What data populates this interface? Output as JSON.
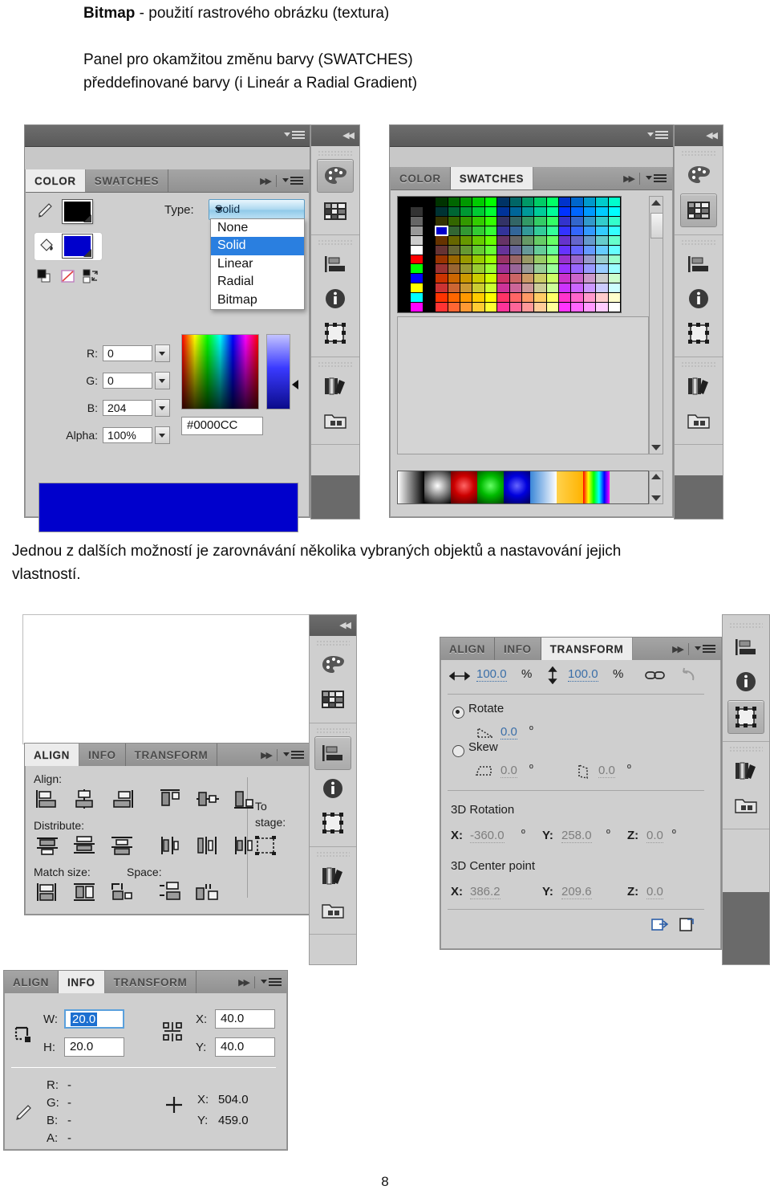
{
  "document": {
    "heading_bold": "Bitmap",
    "heading_rest": " - použití rastrového obrázku (textura)",
    "para1_line1": "Panel pro okamžitou změnu barvy (SWATCHES)",
    "para1_line2": "předdefinované barvy (i Lineár a Radial Gradient)",
    "para2": "Jednou z dalších možností je zarovnávání několika vybraných objektů a nastavování jejich",
    "para2_last": "vlastností.",
    "page_number": "8"
  },
  "color_panel": {
    "tabs": [
      {
        "label": "COLOR",
        "active": true
      },
      {
        "label": "SWATCHES",
        "active": false
      }
    ],
    "type_label": "Type:",
    "type_value": "Solid",
    "type_options": [
      "None",
      "Solid",
      "Linear",
      "Radial",
      "Bitmap"
    ],
    "type_selected_index": 1,
    "stroke_color": "#000000",
    "fill_color": "#0000CC",
    "fields": [
      {
        "label": "R:",
        "value": "0"
      },
      {
        "label": "G:",
        "value": "0"
      },
      {
        "label": "B:",
        "value": "204"
      },
      {
        "label": "Alpha:",
        "value": "100%"
      }
    ],
    "hex_value": "#0000CC",
    "preview_color": "#0000CC",
    "icons": {
      "eyedropper": "pencil-icon",
      "bucket": "paint-bucket-icon",
      "black_white": "black-and-white-icon",
      "no_color": "no-color-icon",
      "swap": "swap-colors-icon"
    }
  },
  "swatches_panel": {
    "tabs": [
      {
        "label": "COLOR",
        "active": false
      },
      {
        "label": "SWATCHES",
        "active": true
      }
    ],
    "selected_swatch": "#0000CC",
    "gradient_swatches": [
      "linear-black-white",
      "radial-white-black",
      "radial-red",
      "radial-green",
      "radial-blue",
      "linear-blue-white",
      "linear-yellow",
      "linear-rainbow"
    ]
  },
  "icon_rail": {
    "items": [
      {
        "name": "color-palette-icon",
        "label": "Color"
      },
      {
        "name": "swatches-grid-icon",
        "label": "Swatches"
      },
      {
        "name": "align-icon",
        "label": "Align"
      },
      {
        "name": "info-icon",
        "label": "Info"
      },
      {
        "name": "transform-icon",
        "label": "Transform"
      },
      {
        "name": "library-icon",
        "label": "Library"
      },
      {
        "name": "folder-icon",
        "label": "Project"
      }
    ],
    "collapse_glyph": "◀◀"
  },
  "align_panel": {
    "tabs": [
      {
        "label": "ALIGN",
        "active": true
      },
      {
        "label": "INFO",
        "active": false
      },
      {
        "label": "TRANSFORM",
        "active": false
      }
    ],
    "groups": {
      "align": "Align:",
      "distribute": "Distribute:",
      "match_size": "Match size:",
      "space": "Space:",
      "to_stage_line1": "To",
      "to_stage_line2": "stage:"
    },
    "buttons": {
      "align": [
        "align-left-icon",
        "align-horizontal-center-icon",
        "align-right-icon",
        "align-top-icon",
        "align-vertical-center-icon",
        "align-bottom-icon"
      ],
      "distribute": [
        "distribute-top-icon",
        "distribute-vertical-center-icon",
        "distribute-bottom-icon",
        "distribute-left-icon",
        "distribute-horizontal-center-icon",
        "distribute-right-icon"
      ],
      "match_size": [
        "match-width-icon",
        "match-height-icon",
        "match-both-icon"
      ],
      "space": [
        "space-evenly-vertical-icon",
        "space-evenly-horizontal-icon"
      ],
      "to_stage": [
        "to-stage-icon"
      ]
    }
  },
  "transform_panel": {
    "tabs": [
      {
        "label": "ALIGN",
        "active": false
      },
      {
        "label": "INFO",
        "active": false
      },
      {
        "label": "TRANSFORM",
        "active": true
      }
    ],
    "scale_width": "100.0",
    "scale_width_unit": "%",
    "scale_height": "100.0",
    "scale_height_unit": "%",
    "rotate_label": "Rotate",
    "rotate_selected": true,
    "rotate_value": "0.0",
    "skew_label": "Skew",
    "skew_selected": false,
    "skew_h": "0.0",
    "skew_v": "0.0",
    "degree_symbol": "º",
    "rotation_3d_label": "3D Rotation",
    "rotation_3d": [
      {
        "label": "X:",
        "value": "-360.0",
        "unit": "º"
      },
      {
        "label": "Y:",
        "value": "258.0",
        "unit": "º"
      },
      {
        "label": "Z:",
        "value": "0.0",
        "unit": "º"
      }
    ],
    "center_3d_label": "3D Center point",
    "center_3d": [
      {
        "label": "X:",
        "value": "386.2"
      },
      {
        "label": "Y:",
        "value": "209.6"
      },
      {
        "label": "Z:",
        "value": "0.0"
      }
    ],
    "footer_buttons": [
      "duplicate-selection-icon",
      "remove-transform-icon"
    ],
    "link_icon": "constrain-link-icon",
    "reset_icon": "reset-icon"
  },
  "info_panel": {
    "tabs": [
      {
        "label": "ALIGN",
        "active": false
      },
      {
        "label": "INFO",
        "active": true
      },
      {
        "label": "TRANSFORM",
        "active": false
      }
    ],
    "width_label": "W:",
    "width_value": "20.0",
    "height_label": "H:",
    "height_value": "20.0",
    "x_label": "X:",
    "x_value": "40.0",
    "y_label": "Y:",
    "y_value": "40.0",
    "channels": [
      {
        "label": "R:",
        "value": "-"
      },
      {
        "label": "G:",
        "value": "-"
      },
      {
        "label": "B:",
        "value": "-"
      },
      {
        "label": "A:",
        "value": "-"
      }
    ],
    "cursor_x_label": "X:",
    "cursor_x_value": "504.0",
    "cursor_y_label": "Y:",
    "cursor_y_value": "459.0",
    "icons": {
      "bounds": "bounding-box-icon",
      "registration": "registration-point-icon",
      "eyedropper": "eyedropper-icon",
      "crosshair": "crosshair-icon"
    }
  }
}
